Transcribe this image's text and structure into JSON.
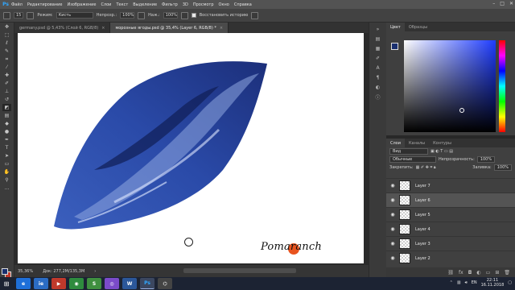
{
  "app": {
    "logo": "Ps"
  },
  "menu": [
    "Файл",
    "Редактирование",
    "Изображение",
    "Слои",
    "Текст",
    "Выделение",
    "Фильтр",
    "3D",
    "Просмотр",
    "Окно",
    "Справка"
  ],
  "window_controls": {
    "minimize": "–",
    "maximize": "□",
    "close": "✕"
  },
  "options_bar": {
    "brush_size": "15",
    "mode_label": "Режим:",
    "mode_value": "Кисть",
    "opacity_label": "Непрозр.:",
    "opacity_value": "100%",
    "pressure_label": "Наж.:",
    "pressure_value": "100%",
    "history_label": "Восстановить историю"
  },
  "tabs": [
    {
      "label": "germany.psd @ 5,43% (Слой 6, RGB/8)",
      "close": "×"
    },
    {
      "label": "морозные ягоды.psd @ 35,4% (Layer 6, RGB/8) *",
      "close": "×"
    }
  ],
  "statusbar": {
    "zoom": "35,36%",
    "doc": "Док: 277,2M/135,3M",
    "arrow": "›"
  },
  "watermark": {
    "text": "Pomaranch"
  },
  "color_panel": {
    "tabs": [
      "Цвет",
      "Образцы"
    ]
  },
  "layers_panel": {
    "tabs": [
      "Слои",
      "Каналы",
      "Контуры"
    ],
    "kind_label": "Вид",
    "blend_mode": "Обычные",
    "opacity_label": "Непрозрачность:",
    "opacity_value": "100%",
    "lock_label": "Закрепить:",
    "fill_label": "Заливка:",
    "fill_value": "100%",
    "layers": [
      {
        "name": "Layer 7",
        "selected": false
      },
      {
        "name": "Layer 6",
        "selected": true
      },
      {
        "name": "Layer 5",
        "selected": false
      },
      {
        "name": "Layer 4",
        "selected": false
      },
      {
        "name": "Layer 3",
        "selected": false
      },
      {
        "name": "Layer 2",
        "selected": false
      }
    ]
  },
  "taskbar": {
    "start": "⊞",
    "apps": [
      "e",
      "ie",
      "▶",
      "◉",
      "S",
      "◎",
      "W",
      "Ps",
      "⌬"
    ],
    "lang": "EN",
    "time": "22:11",
    "date": "16.11.2018"
  },
  "colors": {
    "foreground": "#1a2f6e",
    "background": "#c03a2b",
    "accent": "#31a8ff"
  }
}
